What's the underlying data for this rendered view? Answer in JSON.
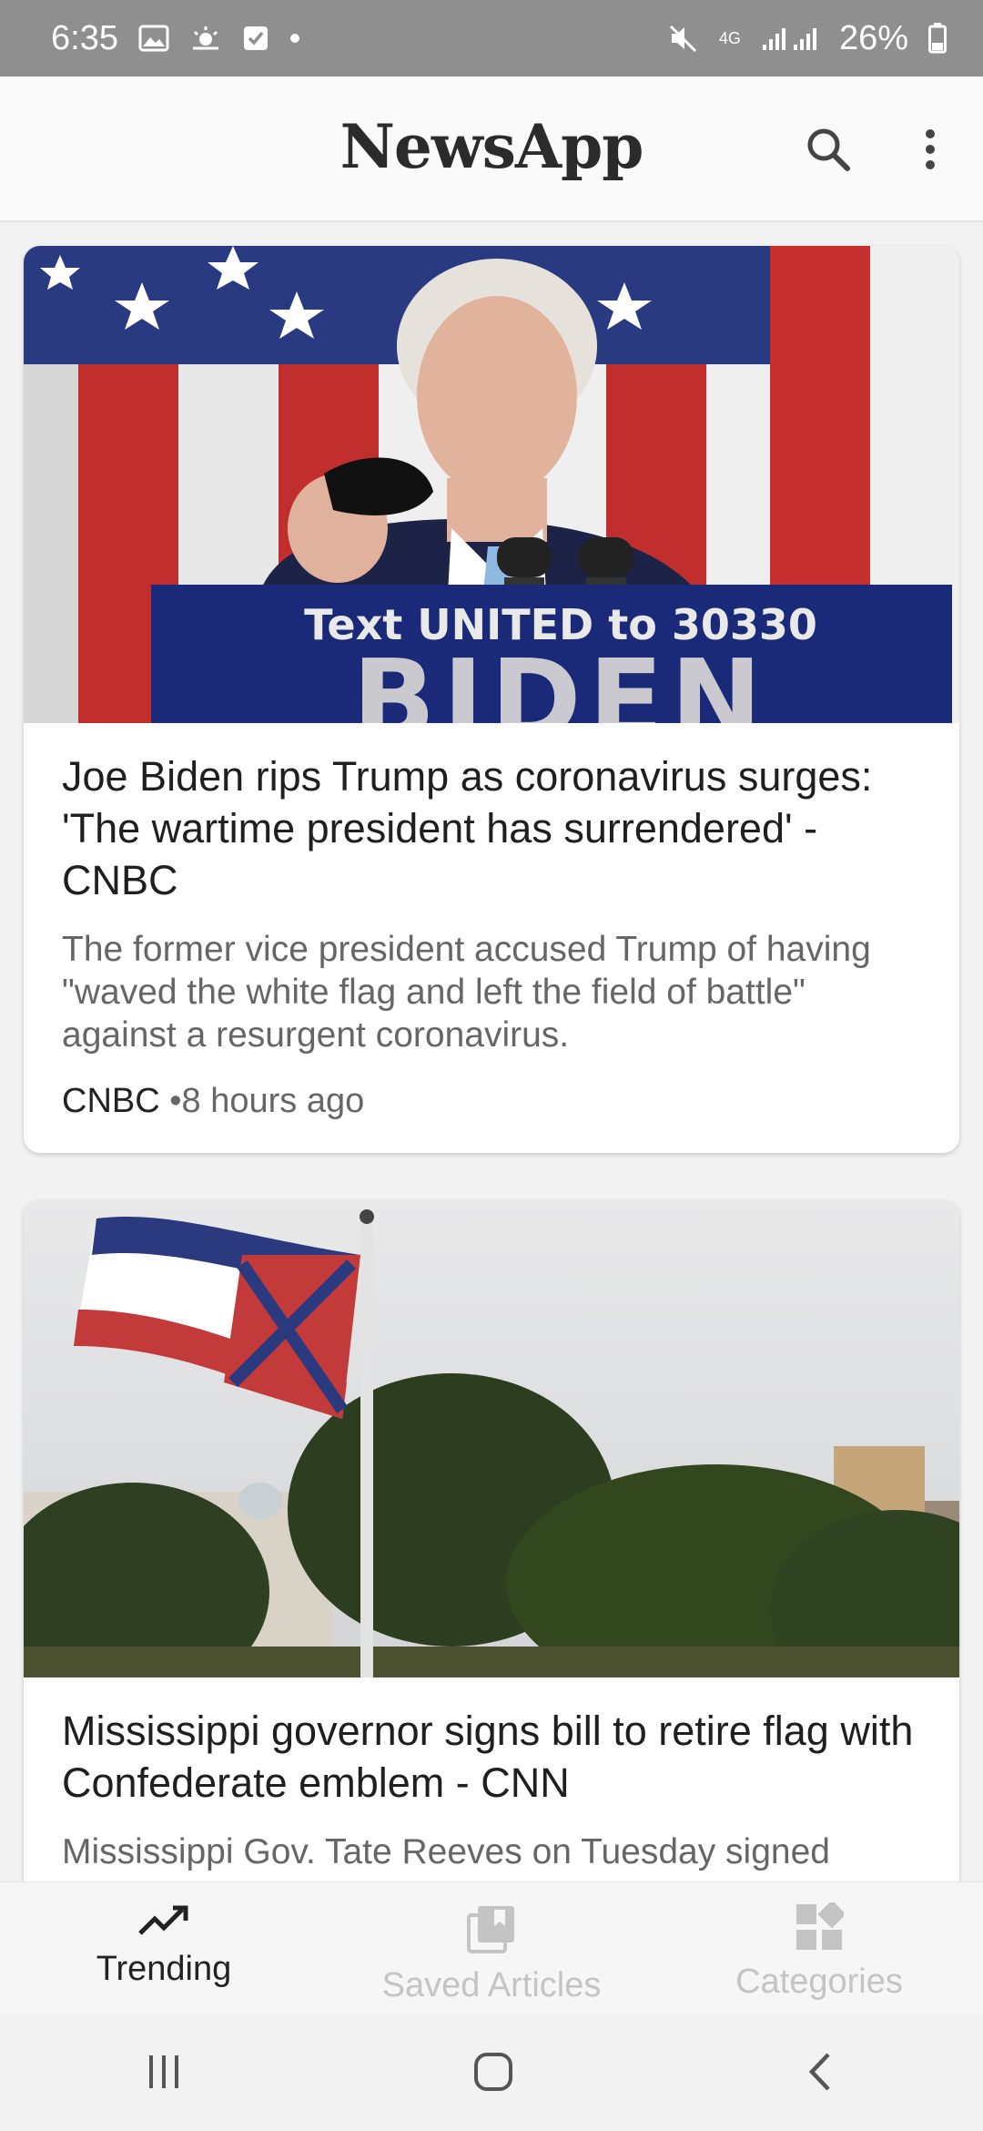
{
  "status_bar": {
    "time": "6:35",
    "network": "4G",
    "battery": "26%"
  },
  "app_bar": {
    "title": "NewsApp"
  },
  "articles": [
    {
      "title": "Joe Biden rips Trump as coronavirus surges: 'The wartime president has surrendered' - CNBC",
      "description": "The former vice president accused Trump of having \"waved the white flag and left the field of battle\" against a resurgent coronavirus.",
      "source": "CNBC",
      "time": "•8 hours ago",
      "image_text_line1": "Text UNITED to 30330",
      "image_text_line2": "BIDEN"
    },
    {
      "title": "Mississippi governor signs bill to retire flag with Confederate emblem - CNN",
      "description": "Mississippi Gov. Tate Reeves on Tuesday signed"
    }
  ],
  "bottom_nav": {
    "items": [
      {
        "label": "Trending",
        "icon": "trending-icon",
        "active": true
      },
      {
        "label": "Saved Articles",
        "icon": "saved-articles-icon",
        "active": false
      },
      {
        "label": "Categories",
        "icon": "categories-icon",
        "active": false
      }
    ]
  },
  "colors": {
    "status_bar_bg": "#8f8f8f",
    "active": "#222222",
    "inactive": "#c4c4c4"
  }
}
